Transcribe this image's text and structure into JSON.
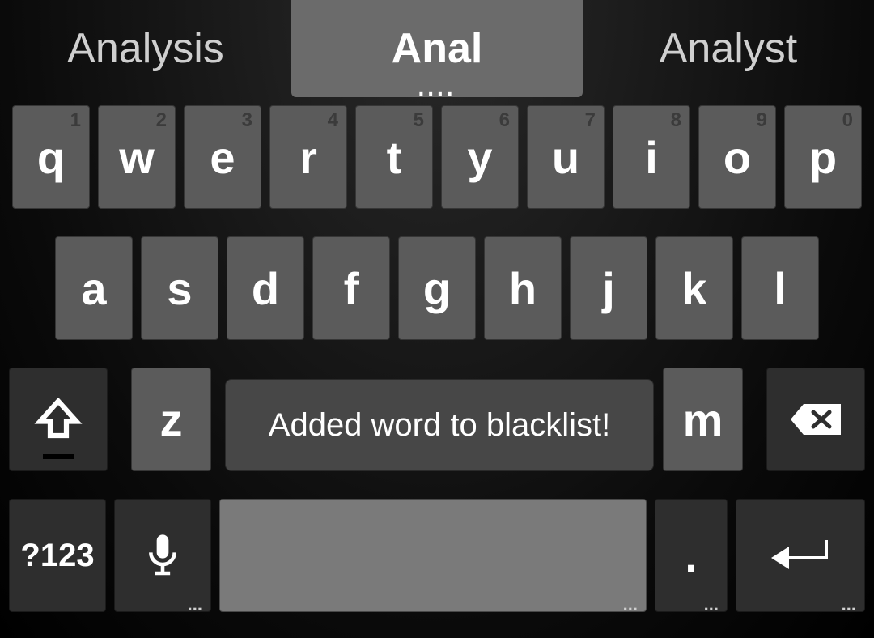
{
  "suggestions": {
    "left": "Analysis",
    "center": "Anal",
    "right": "Analyst",
    "center_more": "...."
  },
  "rows": {
    "r1": [
      {
        "label": "q",
        "sub": "1"
      },
      {
        "label": "w",
        "sub": "2"
      },
      {
        "label": "e",
        "sub": "3"
      },
      {
        "label": "r",
        "sub": "4"
      },
      {
        "label": "t",
        "sub": "5"
      },
      {
        "label": "y",
        "sub": "6"
      },
      {
        "label": "u",
        "sub": "7"
      },
      {
        "label": "i",
        "sub": "8"
      },
      {
        "label": "o",
        "sub": "9"
      },
      {
        "label": "p",
        "sub": "0"
      }
    ],
    "r2": [
      {
        "label": "a"
      },
      {
        "label": "s"
      },
      {
        "label": "d"
      },
      {
        "label": "f"
      },
      {
        "label": "g"
      },
      {
        "label": "h"
      },
      {
        "label": "j"
      },
      {
        "label": "k"
      },
      {
        "label": "l"
      }
    ],
    "r3": {
      "z": "z",
      "m": "m"
    },
    "r4": {
      "sym": "?123",
      "period": ".",
      "more": "..."
    }
  },
  "toast": {
    "message": "Added word to blacklist!"
  }
}
